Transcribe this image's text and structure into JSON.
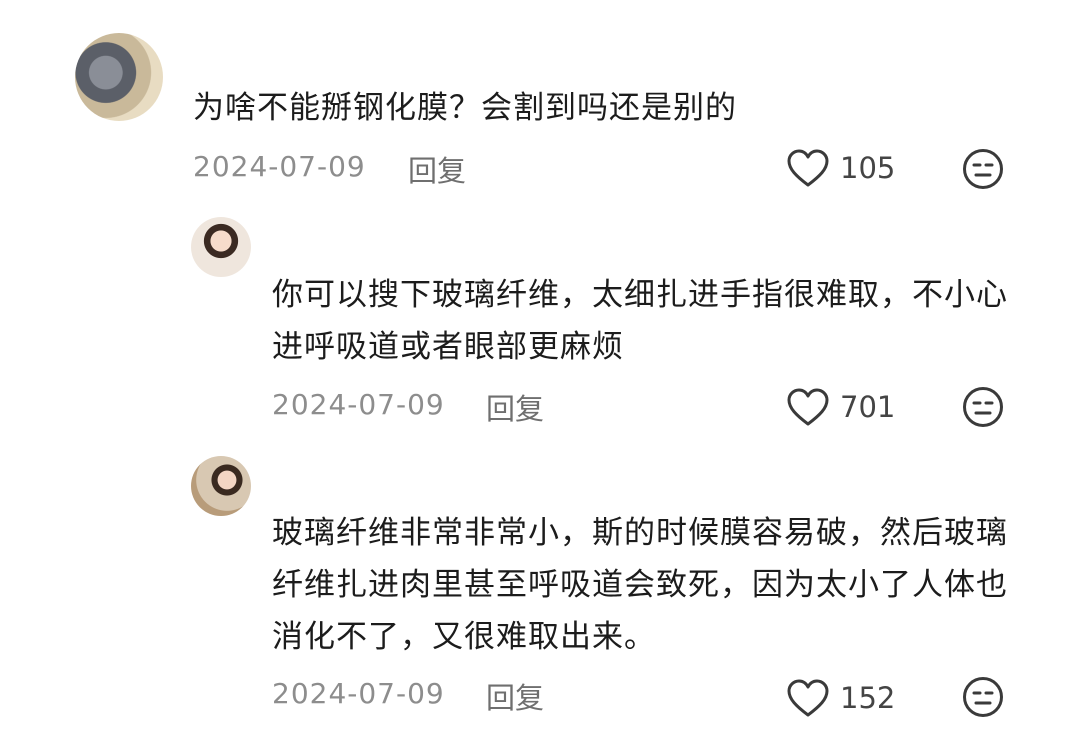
{
  "comments": [
    {
      "text": "为啥不能掰钢化膜？会割到吗还是别的",
      "date": "2024-07-09",
      "reply_label": "回复",
      "likes": "105"
    },
    {
      "text": "你可以搜下玻璃纤维，太细扎进手指很难取，不小心进呼吸道或者眼部更麻烦",
      "date": "2024-07-09",
      "reply_label": "回复",
      "likes": "701"
    },
    {
      "text": "玻璃纤维非常非常小，斯的时候膜容易破，然后玻璃纤维扎进肉里甚至呼吸道会致死，因为太小了人体也消化不了，又很难取出来。",
      "date": "2024-07-09",
      "reply_label": "回复",
      "likes": "152"
    }
  ],
  "icons": {
    "like": "heart-outline-icon",
    "dislike": "neutral-face-icon"
  }
}
